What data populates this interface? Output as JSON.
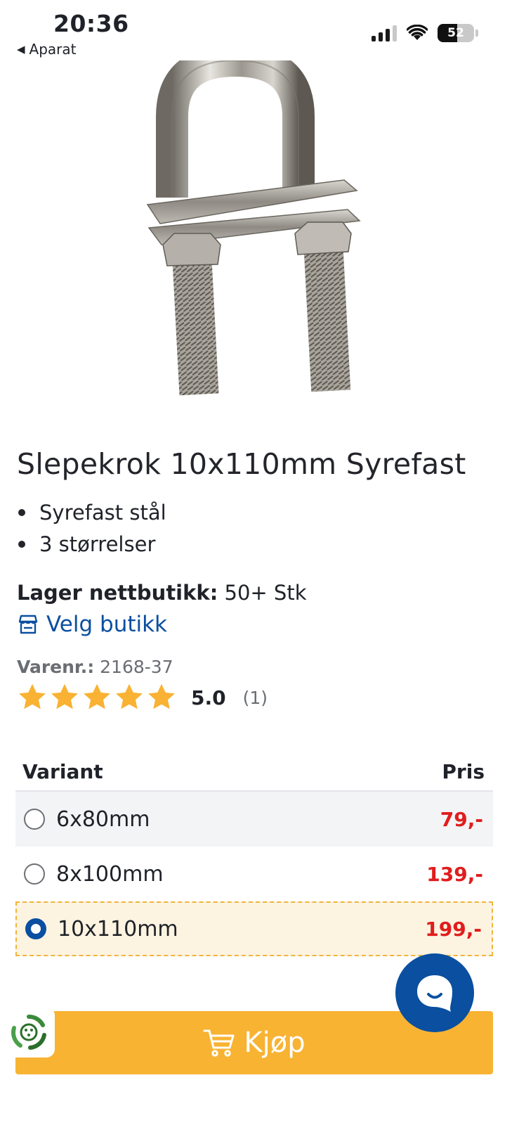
{
  "status_bar": {
    "time": "20:36",
    "back_label": "Aparat",
    "battery": "52"
  },
  "product": {
    "title": "Slepekrok 10x110mm Syrefast",
    "features": [
      "Syrefast stål",
      "3 størrelser"
    ],
    "stock_label": "Lager nettbutikk:",
    "stock_value": "50+ Stk",
    "store_link": "Velg butikk",
    "sku_label": "Varenr.:",
    "sku_value": "2168-37",
    "rating_value": "5.0",
    "rating_count": "(1)",
    "rating_stars": 5
  },
  "variants": {
    "header_variant": "Variant",
    "header_price": "Pris",
    "rows": [
      {
        "name": "6x80mm",
        "price": "79,-",
        "selected": false
      },
      {
        "name": "8x100mm",
        "price": "139,-",
        "selected": false
      },
      {
        "name": "10x110mm",
        "price": "199,-",
        "selected": true
      }
    ]
  },
  "buy_button": {
    "label": "Kjøp"
  },
  "colors": {
    "brand_blue": "#0a4fa0",
    "buy_yellow": "#f8b333",
    "price_red": "#e11d1d",
    "star": "#f9b233"
  },
  "icons": [
    "back-arrow-icon",
    "cellular-signal-icon",
    "wifi-icon",
    "battery-icon",
    "store-icon",
    "star-icon",
    "cart-icon",
    "chat-icon",
    "recycle-icon"
  ]
}
